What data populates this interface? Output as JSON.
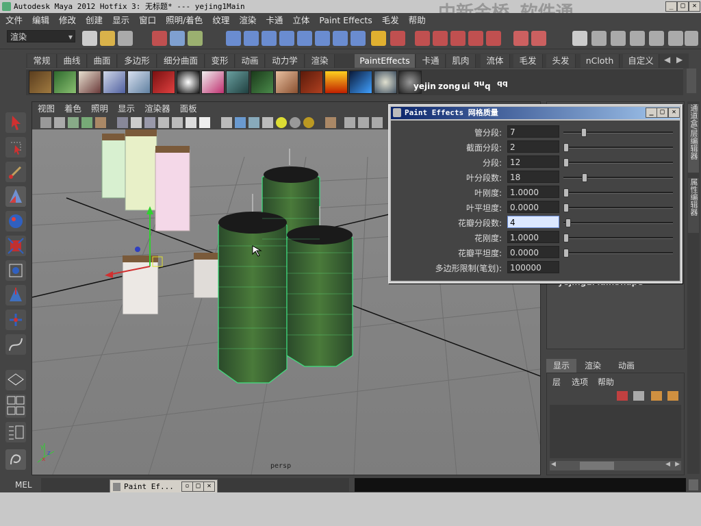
{
  "titlebar": {
    "title": "Autodesk Maya 2012 Hotfix 3: 无标题*   ---   yejing1Main",
    "watermark": "中新金桥 软件通"
  },
  "menubar": {
    "items": [
      "文件",
      "编辑",
      "修改",
      "创建",
      "显示",
      "窗口",
      "照明/着色",
      "纹理",
      "渲染",
      "卡通",
      "立体",
      "Paint Effects",
      "毛发",
      "帮助"
    ]
  },
  "statusline": {
    "mode_select": "渲染"
  },
  "shelf": {
    "tabs": [
      "常规",
      "曲线",
      "曲面",
      "多边形",
      "细分曲面",
      "变形",
      "动画",
      "动力学",
      "渲染",
      "PaintEffects",
      "卡通",
      "肌肉",
      "流体",
      "毛发",
      "头发",
      "nCloth",
      "自定义"
    ],
    "active_tab": "PaintEffects",
    "brush_labels": [
      "yejin",
      "zong",
      "ui",
      "qu",
      "q",
      "qq"
    ]
  },
  "viewport": {
    "menu": [
      "视图",
      "着色",
      "照明",
      "显示",
      "渲染器",
      "面板"
    ],
    "camera_label": "persp",
    "behind_label": "yejing1MainShape"
  },
  "dialog": {
    "title": "Paint Effects 网格质量",
    "fields": [
      {
        "label": "管分段:",
        "value": "7",
        "slider": 0.17
      },
      {
        "label": "截面分段:",
        "value": "2",
        "slider": 0.0
      },
      {
        "label": "分段:",
        "value": "12",
        "slider": 0.0
      },
      {
        "label": "叶分段数:",
        "value": "18",
        "slider": 0.18
      },
      {
        "label": "叶刚度:",
        "value": "1.0000",
        "slider": 0.0
      },
      {
        "label": "叶平坦度:",
        "value": "0.0000",
        "slider": 0.0
      },
      {
        "label": "花瓣分段数:",
        "value": "4",
        "slider": 0.02,
        "active": true
      },
      {
        "label": "花刚度:",
        "value": "1.0000",
        "slider": 0.0
      },
      {
        "label": "花瓣平坦度:",
        "value": "0.0000",
        "slider": 0.0
      },
      {
        "label": "多边形限制(笔划):",
        "value": "100000"
      }
    ]
  },
  "rightpanel": {
    "tabs": [
      "显示",
      "渲染",
      "动画"
    ],
    "menu": [
      "层",
      "选项",
      "帮助"
    ],
    "side_tabs": [
      "通道盒/层编辑器",
      "属性编辑器"
    ]
  },
  "cmdline": {
    "label": "MEL"
  },
  "taskbar": {
    "minimized_title": "Paint Ef..."
  }
}
